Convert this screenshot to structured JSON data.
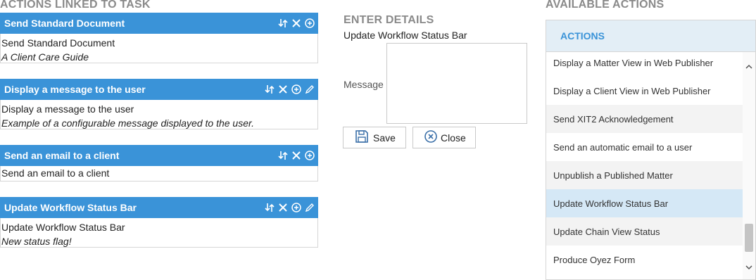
{
  "left": {
    "title": "ACTIONS LINKED TO TASK",
    "cards": [
      {
        "title": "Send Standard Document",
        "name": "Send Standard Document",
        "desc": "A Client Care Guide"
      },
      {
        "title": "Display a message to the user",
        "name": "Display a message to the user",
        "desc": "Example of a configurable message displayed to the user."
      },
      {
        "title": "Send an email to a client",
        "name": "Send an email to a client",
        "desc": ""
      },
      {
        "title": "Update Workflow Status Bar",
        "name": "Update Workflow Status Bar",
        "desc": "New status flag!"
      }
    ]
  },
  "middle": {
    "title": "ENTER DETAILS",
    "action_name": "Update Workflow Status Bar",
    "message_label": "Message",
    "message_value": "",
    "save_label": "Save",
    "close_label": "Close"
  },
  "right": {
    "title": "AVAILABLE ACTIONS",
    "header": "ACTIONS",
    "items": [
      "Display a Matter View in Web Publisher",
      "Display a Client View in Web Publisher",
      "Send XIT2 Acknowledgement",
      "Send an automatic email to a user",
      "Unpublish a Published Matter",
      "Update Workflow Status Bar",
      "Update Chain View Status",
      "Produce Oyez Form"
    ],
    "selected": "Update Workflow Status Bar"
  },
  "colors": {
    "accent": "#3a93d8",
    "selected_row": "#d5e8f6",
    "panel_header_bg": "#e3eef6"
  },
  "icons": {
    "reorder": "move-arrows-icon",
    "remove": "close-icon",
    "add": "plus-circle-icon",
    "edit": "pencil-icon"
  }
}
